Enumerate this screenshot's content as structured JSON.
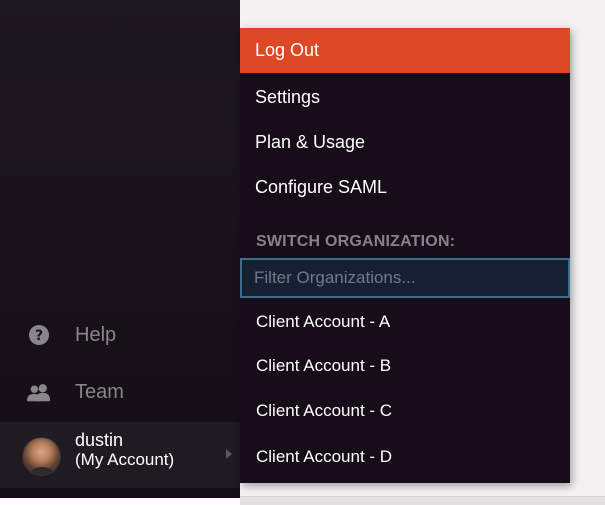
{
  "sidebar": {
    "items": [
      {
        "label": "Help",
        "icon": "question-circle-icon"
      },
      {
        "label": "Team",
        "icon": "team-users-icon"
      }
    ],
    "account": {
      "name": "dustin",
      "subtitle": "(My Account)"
    }
  },
  "menu": {
    "items": [
      {
        "label": "Log Out"
      },
      {
        "label": "Settings"
      },
      {
        "label": "Plan & Usage"
      },
      {
        "label": "Configure SAML"
      }
    ],
    "section_header": "SWITCH ORGANIZATION:",
    "filter": {
      "placeholder": "Filter Organizations...",
      "value": ""
    },
    "organizations": [
      {
        "label": "Client Account - A"
      },
      {
        "label": "Client Account - B"
      },
      {
        "label": "Client Account - C"
      },
      {
        "label": "Client Account - D"
      }
    ]
  },
  "colors": {
    "accent": "#dd4826",
    "sidebar_bg": "#1a131b",
    "dropdown_bg": "#170d18",
    "input_border": "#3d6d8e"
  }
}
